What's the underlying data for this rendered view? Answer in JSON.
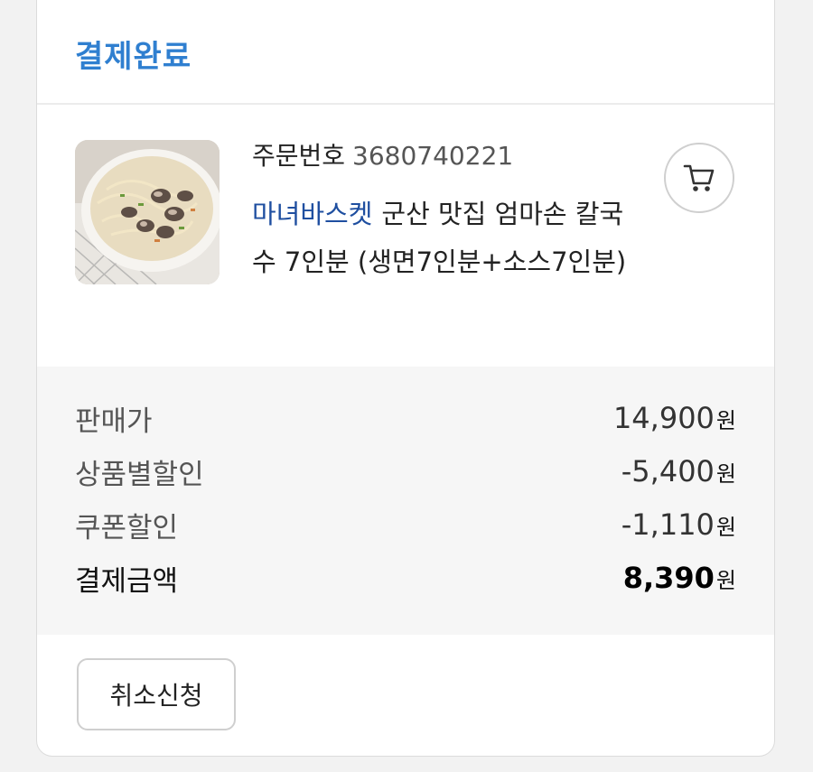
{
  "order": {
    "status": "결제완료",
    "number_label": "주문번호",
    "number": "3680740221",
    "brand": "마녀바스켓",
    "product_name": "군산 맛집 엄마손 칼국수 7인분 (생면7인분+소스7인분)",
    "cart_icon": "cart-icon"
  },
  "prices": {
    "unit": "원",
    "rows": [
      {
        "label": "판매가",
        "value": "14,900"
      },
      {
        "label": "상품별할인",
        "value": "-5,400"
      },
      {
        "label": "쿠폰할인",
        "value": "-1,110"
      },
      {
        "label": "결제금액",
        "value": "8,390"
      }
    ]
  },
  "actions": {
    "cancel_label": "취소신청"
  },
  "colors": {
    "status": "#2f7fd0",
    "brand": "#1f4fa0"
  }
}
